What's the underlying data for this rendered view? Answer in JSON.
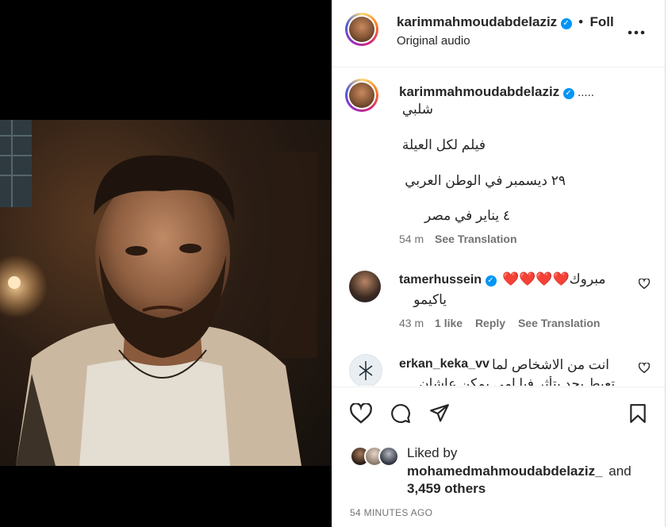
{
  "header": {
    "username": "karimmahmoudabdelaziz",
    "dot": "•",
    "follow_label": "Foll",
    "subtitle": "Original audio",
    "more_icon": "more-horizontal-icon"
  },
  "caption": {
    "username": "karimmahmoudabdelaziz",
    "ellipsis": ".....",
    "lines": [
      "شلبي",
      "فيلم لكل العيلة",
      "٢٩ ديسمبر في الوطن العربي",
      "٤ يناير في مصر"
    ],
    "time": "54 m",
    "see_translation": "See Translation"
  },
  "comments": [
    {
      "username": "tamerhussein",
      "text_line1": "مبروك❤️❤️❤️❤️",
      "text_line2": "ياكيمو",
      "time": "43 m",
      "likes": "1 like",
      "reply": "Reply",
      "see_translation": "See Translation"
    },
    {
      "username": "erkan_keka_vv",
      "text_line1": "انت من الاشخاص لما",
      "text_line2": "تعيط بحد يتأثر فيا امي يمكن عاشان"
    }
  ],
  "liked_by": {
    "prefix": "Liked by",
    "user": "mohamedmahmoudabdelaziz_",
    "and": "and",
    "others": "3,459 others"
  },
  "timestamp": "54 MINUTES AGO",
  "icons": {
    "like": "heart-icon",
    "comment": "comment-icon",
    "share": "share-icon",
    "save": "bookmark-icon"
  },
  "colors": {
    "verified": "#0095f6",
    "secondary_text": "#737373",
    "primary_text": "#262626",
    "heart_red": "#ed1c24"
  }
}
